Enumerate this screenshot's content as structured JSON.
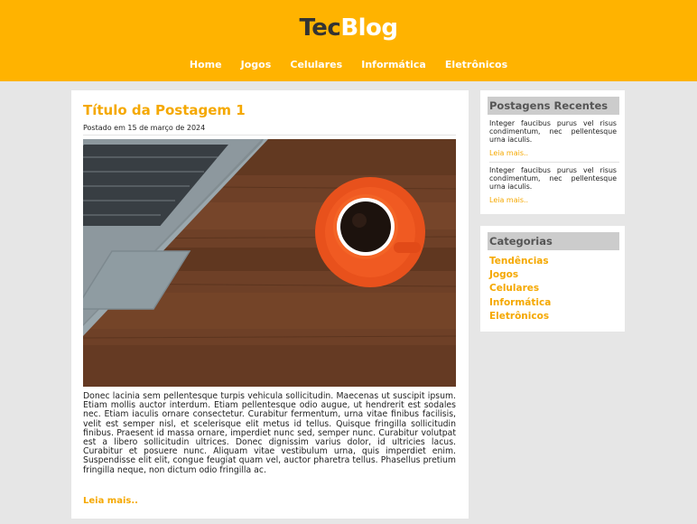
{
  "brand": {
    "part1": "Tec",
    "part2": "Blog"
  },
  "nav": [
    "Home",
    "Jogos",
    "Celulares",
    "Informática",
    "Eletrônicos"
  ],
  "post": {
    "title": "Título da Postagem 1",
    "date": "Postado em 15 de março de 2024",
    "body": "Donec lacinia sem pellentesque turpis vehicula sollicitudin. Maecenas ut suscipit ipsum. Etiam mollis auctor interdum. Etiam pellentesque odio augue, ut hendrerit est sodales nec. Etiam iaculis ornare consectetur. Curabitur fermentum, urna vitae finibus facilisis, velit est semper nisl, et scelerisque elit metus id tellus. Quisque fringilla sollicitudin finibus. Praesent id massa ornare, imperdiet nunc sed, semper nunc. Curabitur volutpat est a libero sollicitudin ultrices. Donec dignissim varius dolor, id ultricies lacus. Curabitur et posuere nunc. Aliquam vitae vestibulum urna, quis imperdiet enim. Suspendisse elit elit, congue feugiat quam vel, auctor pharetra tellus. Phasellus pretium fringilla neque, non dictum odio fringilla ac.",
    "read_more": "Leia mais.."
  },
  "sidebar": {
    "recent": {
      "title": "Postagens Recentes",
      "items": [
        {
          "text": "Integer faucibus purus vel risus condimentum, nec pellentesque urna iaculis.",
          "more": "Leia mais.."
        },
        {
          "text": "Integer faucibus purus vel risus condimentum, nec pellentesque urna iaculis.",
          "more": "Leia mais.."
        }
      ]
    },
    "categories": {
      "title": "Categorias",
      "items": [
        "Tendências",
        "Jogos",
        "Celulares",
        "Informática",
        "Eletrônicos"
      ]
    }
  },
  "colors": {
    "accent": "#ffb300",
    "link": "#f5a800",
    "background": "#e6e6e6"
  }
}
